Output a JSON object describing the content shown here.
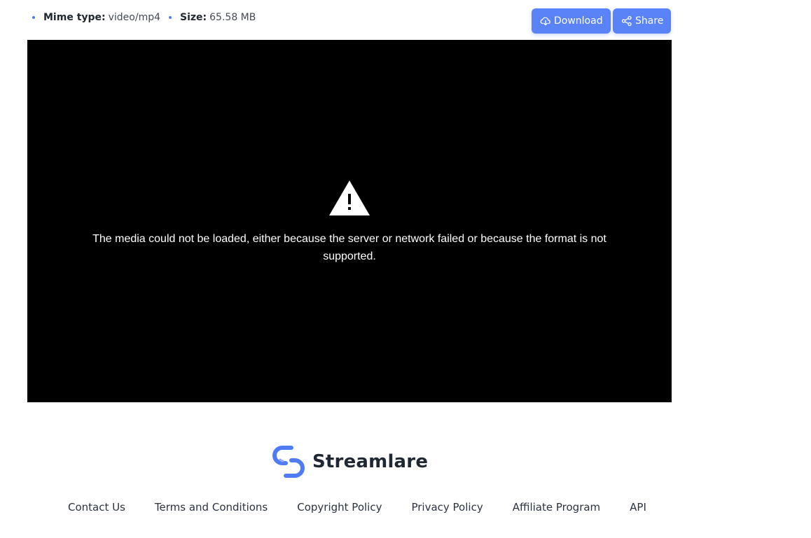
{
  "meta": {
    "mime_label": "Mime type:",
    "mime_value": "video/mp4",
    "size_label": "Size:",
    "size_value": "65.58 MB"
  },
  "actions": {
    "download_label": "Download",
    "share_label": "Share"
  },
  "player": {
    "error_message": "The media could not be loaded, either because the server or network failed or because the format is not supported."
  },
  "brand": {
    "name": "Streamlare"
  },
  "footer": {
    "links": [
      "Contact Us",
      "Terms and Conditions",
      "Copyright Policy",
      "Privacy Policy",
      "Affiliate Program",
      "API"
    ]
  },
  "colors": {
    "accent": "#5a83f7",
    "bullet": "#4f7cf6",
    "player_bg": "#000000"
  },
  "icons": {
    "download": "cloud-download-icon",
    "share": "share-icon",
    "warning": "warning-icon",
    "logo": "streamlare-logo-icon"
  }
}
